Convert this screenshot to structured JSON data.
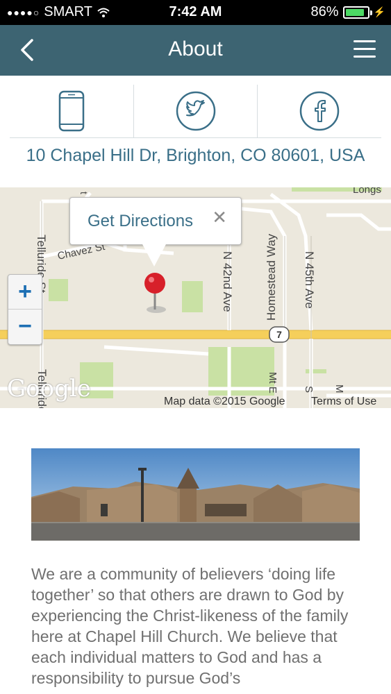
{
  "status_bar": {
    "carrier": "SMART",
    "time": "7:42 AM",
    "battery": "86%",
    "battery_level": 0.86
  },
  "nav": {
    "title": "About"
  },
  "contact_icons": [
    "phone-icon",
    "twitter-icon",
    "facebook-icon"
  ],
  "address": "10 Chapel Hill Dr, Brighton, CO 80601, USA",
  "map": {
    "callout_label": "Get Directions",
    "zoom_in": "+",
    "zoom_out": "−",
    "street_labels": [
      "Chavez St",
      "Telluride St",
      "N 42nd Ave",
      "Homestead Way",
      "N 45th Ave",
      "Longs",
      "Mt E",
      "7"
    ],
    "credit": "Map data ©2015 Google",
    "terms": "Terms of Use",
    "logo": "Google"
  },
  "about_text": "We are a community of believers ‘doing life together’ so that others are drawn to God by experiencing the Christ-likeness of the family here at Chapel Hill Church. We believe that each individual matters to God and has a responsibility to pursue God’s"
}
